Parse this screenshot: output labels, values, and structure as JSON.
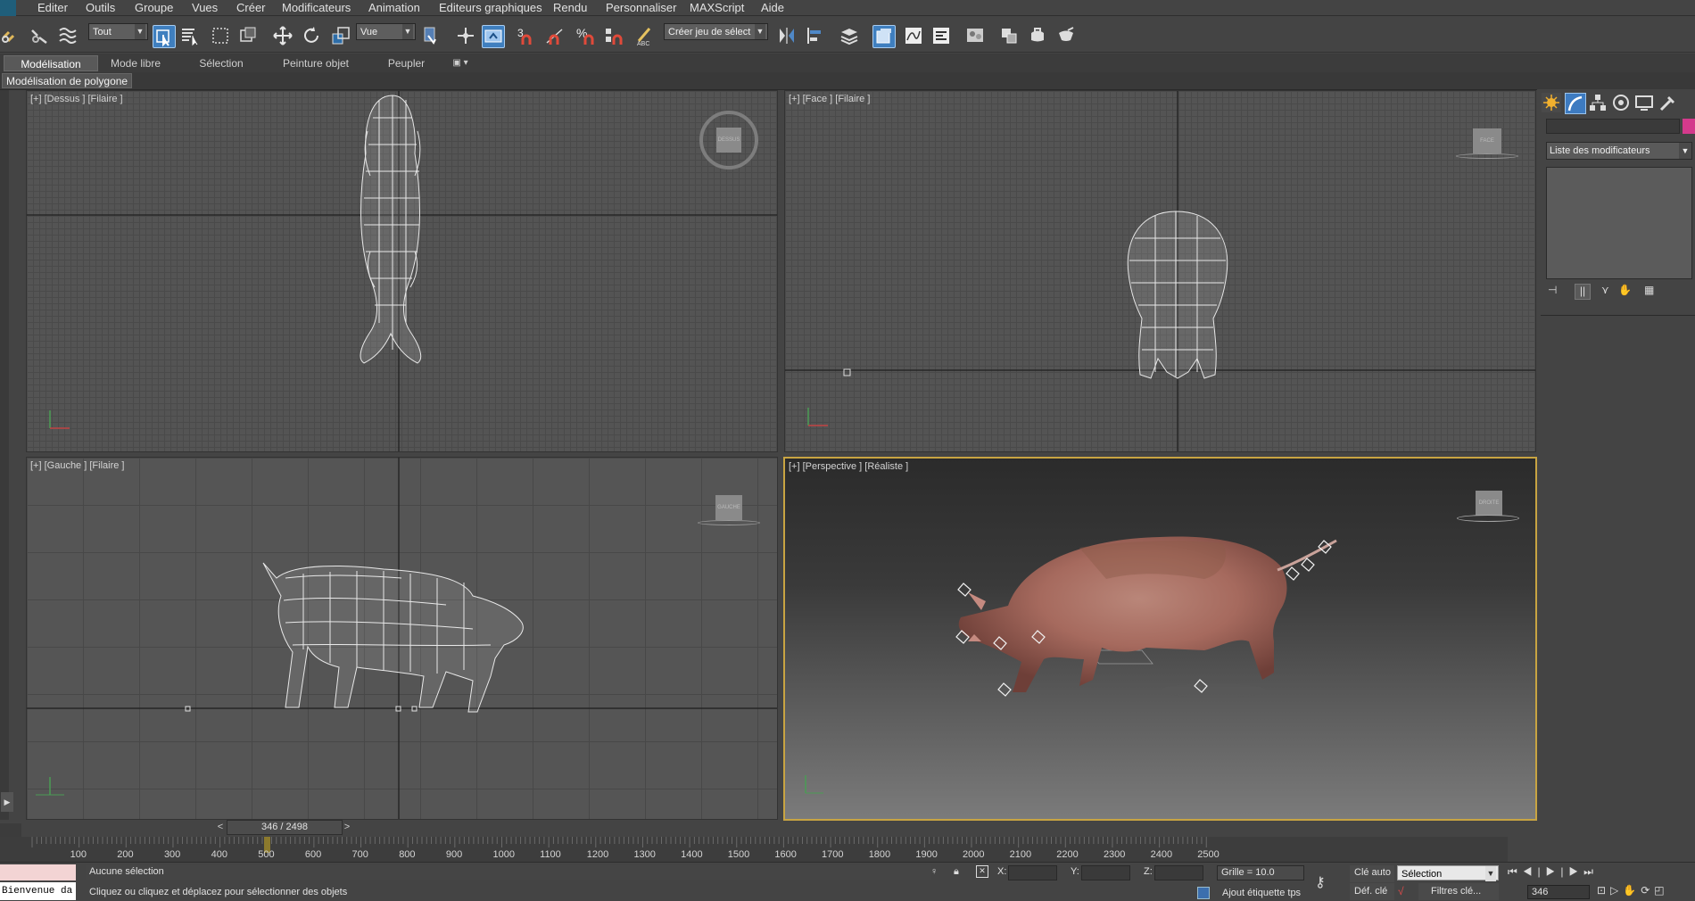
{
  "menu": [
    "Editer",
    "Outils",
    "Groupe",
    "Vues",
    "Créer",
    "Modificateurs",
    "Animation",
    "Editeurs graphiques",
    "Rendu",
    "Personnaliser",
    "MAXScript",
    "Aide"
  ],
  "toolbar": {
    "selection_filter": "Tout",
    "ref_coord": "Vue",
    "named_selection_placeholder": "Créer jeu de sélect"
  },
  "ribbon": {
    "tabs": [
      "Modélisation",
      "Mode libre",
      "Sélection",
      "Peinture objet",
      "Peupler"
    ],
    "active_tab": "Modélisation",
    "panel_label": "Modélisation de polygone"
  },
  "viewports": {
    "top": {
      "label": "[+] [Dessus ] [Filaire ]",
      "cube": "DESSUS"
    },
    "front": {
      "label": "[+] [Face ] [Filaire ]",
      "cube": "FACE"
    },
    "left": {
      "label": "[+] [Gauche ] [Filaire ]",
      "cube": "GAUCHE"
    },
    "persp": {
      "label": "[+] [Perspective ] [Réaliste ]",
      "cube": "DROITE"
    }
  },
  "command_panel": {
    "modifier_list": "Liste des modificateurs",
    "accent_color": "#d43a8c"
  },
  "timeline": {
    "frame_display": "346 / 2498",
    "current_frame": 346,
    "total_frames": 2498,
    "ticks": [
      "100",
      "200",
      "300",
      "400",
      "500",
      "600",
      "700",
      "800",
      "900",
      "1000",
      "1100",
      "1200",
      "1300",
      "1400",
      "1500",
      "1600",
      "1700",
      "1800",
      "1900",
      "2000",
      "2100",
      "2200",
      "2300",
      "2400",
      "2500"
    ]
  },
  "status": {
    "maxscript_listener": "Bienvenue da",
    "selection_info": "Aucune sélection",
    "prompt": "Cliquez ou cliquez et déplacez pour sélectionner des objets",
    "x_label": "X:",
    "y_label": "Y:",
    "z_label": "Z:",
    "grid": "Grille = 10.0",
    "add_time_tag": "Ajout étiquette tps",
    "auto_key": "Clé auto",
    "set_key": "Déf. clé",
    "key_mode": "Sélection",
    "key_filters": "Filtres clé...",
    "frame_field": "346"
  }
}
